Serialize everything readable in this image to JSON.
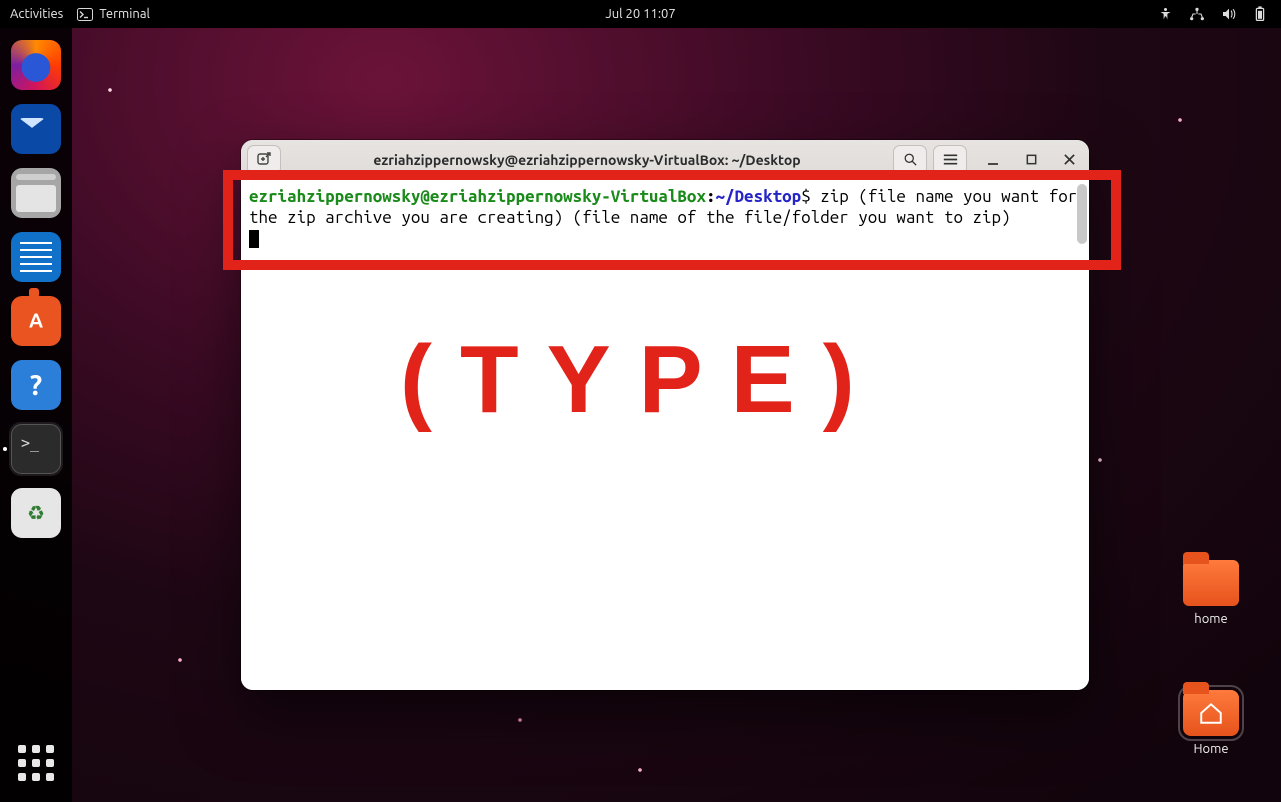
{
  "topbar": {
    "activities": "Activities",
    "app_label": "Terminal",
    "datetime": "Jul 20  11:07"
  },
  "dock": {
    "items": [
      {
        "name": "firefox",
        "label": "Firefox"
      },
      {
        "name": "thunderbird",
        "label": "Thunderbird"
      },
      {
        "name": "files",
        "label": "Files"
      },
      {
        "name": "writer",
        "label": "LibreOffice Writer"
      },
      {
        "name": "software",
        "label": "Ubuntu Software"
      },
      {
        "name": "help",
        "label": "Help"
      },
      {
        "name": "terminal",
        "label": "Terminal"
      },
      {
        "name": "trash",
        "label": "Trash"
      }
    ]
  },
  "desktop_icons": {
    "folder1_label": "home",
    "home_label": "Home"
  },
  "terminal": {
    "title": "ezriahzippernowsky@ezriahzippernowsky-VirtualBox: ~/Desktop",
    "prompt_user": "ezriahzippernowsky@ezriahzippernowsky-VirtualBox",
    "prompt_sep": ":",
    "prompt_path": "~/Desktop",
    "prompt_sym": "$",
    "command_line": " zip (file name you want for the zip archive you are creating) (file name of the file/folder you want to zip)"
  },
  "help_glyph": "?",
  "annotation": {
    "label": "(TYPE)"
  }
}
